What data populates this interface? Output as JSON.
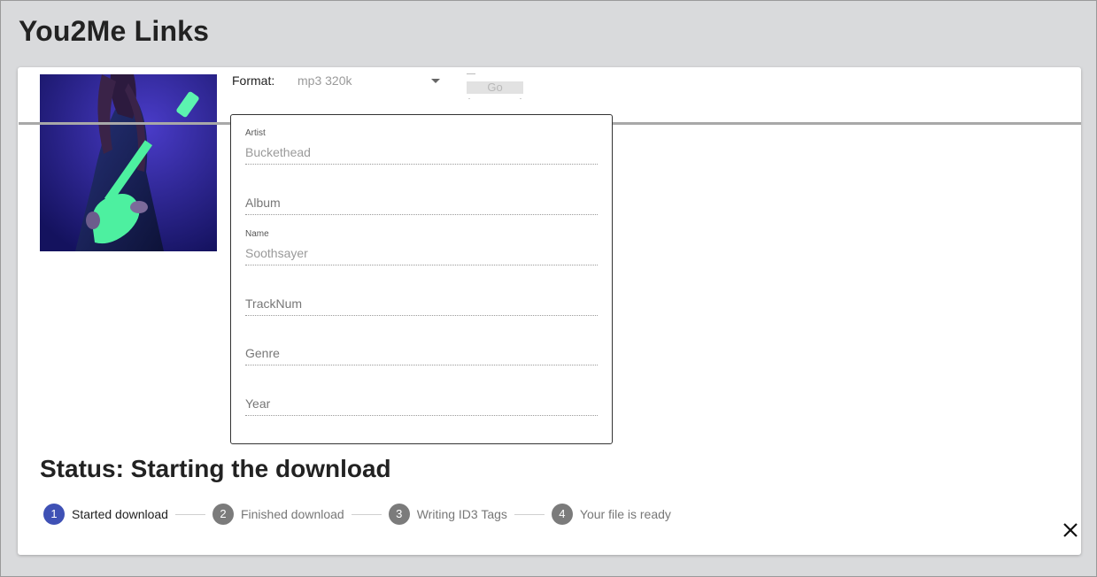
{
  "app": {
    "title": "You2Me Links"
  },
  "format": {
    "label": "Format:",
    "selected": "mp3 320k",
    "go_label": "Go"
  },
  "tags": {
    "artist": {
      "label": "Artist",
      "value": "Buckethead"
    },
    "album": {
      "placeholder": "Album"
    },
    "name": {
      "label": "Name",
      "value": "Soothsayer"
    },
    "tracknum": {
      "placeholder": "TrackNum"
    },
    "genre": {
      "placeholder": "Genre"
    },
    "year": {
      "placeholder": "Year"
    }
  },
  "status": {
    "text": "Status: Starting the download"
  },
  "steps": [
    {
      "number": "1",
      "label": "Started download",
      "active": true
    },
    {
      "number": "2",
      "label": "Finished download",
      "active": false
    },
    {
      "number": "3",
      "label": "Writing ID3 Tags",
      "active": false
    },
    {
      "number": "4",
      "label": "Your file is ready",
      "active": false
    }
  ],
  "icons": {
    "close": "close-icon",
    "dropdown": "chevron-down-icon"
  },
  "colors": {
    "accent": "#3f51b5",
    "background": "#d9dadc",
    "card": "#ffffff"
  }
}
